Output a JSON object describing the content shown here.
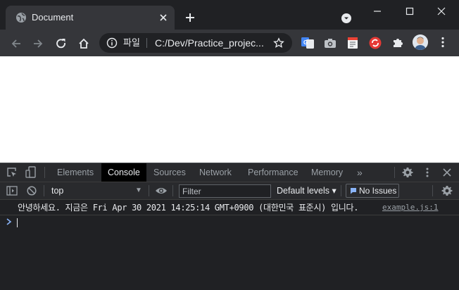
{
  "tab": {
    "title": "Document"
  },
  "address_bar": {
    "scheme_label": "파일",
    "url": "C:/Dev/Practice_projec..."
  },
  "devtools": {
    "tabs": [
      {
        "label": "Elements",
        "active": false
      },
      {
        "label": "Console",
        "active": true
      },
      {
        "label": "Sources",
        "active": false
      },
      {
        "label": "Network",
        "active": false
      },
      {
        "label": "Performance",
        "active": false
      },
      {
        "label": "Memory",
        "active": false
      }
    ],
    "more_tabs_label": "»",
    "context": "top",
    "filter_placeholder": "Filter",
    "levels_label": "Default levels ▾",
    "issues_label": "No Issues"
  },
  "console": {
    "messages": [
      {
        "text": "안녕하세요. 지금은 Fri Apr 30 2021 14:25:14 GMT+0900 (대한민국 표준시) 입니다.",
        "source": "example.js:1"
      }
    ],
    "prompt": ">"
  },
  "colors": {
    "accent": "#8ab4f8",
    "background": "#202124",
    "toolbar": "#35363a",
    "panel": "#292a2d"
  },
  "icons": [
    "globe-icon",
    "close-icon",
    "plus-icon",
    "tab-search-icon",
    "minimize-icon",
    "maximize-icon",
    "back-icon",
    "forward-icon",
    "reload-icon",
    "home-icon",
    "info-icon",
    "star-icon",
    "google-translate-icon",
    "camera-icon",
    "note-icon",
    "red-extension-icon",
    "puzzle-icon",
    "avatar",
    "kebab-icon",
    "inspect-icon",
    "device-icon",
    "settings-icon",
    "sidebar-icon",
    "clear-icon",
    "eye-icon",
    "chat-icon"
  ]
}
